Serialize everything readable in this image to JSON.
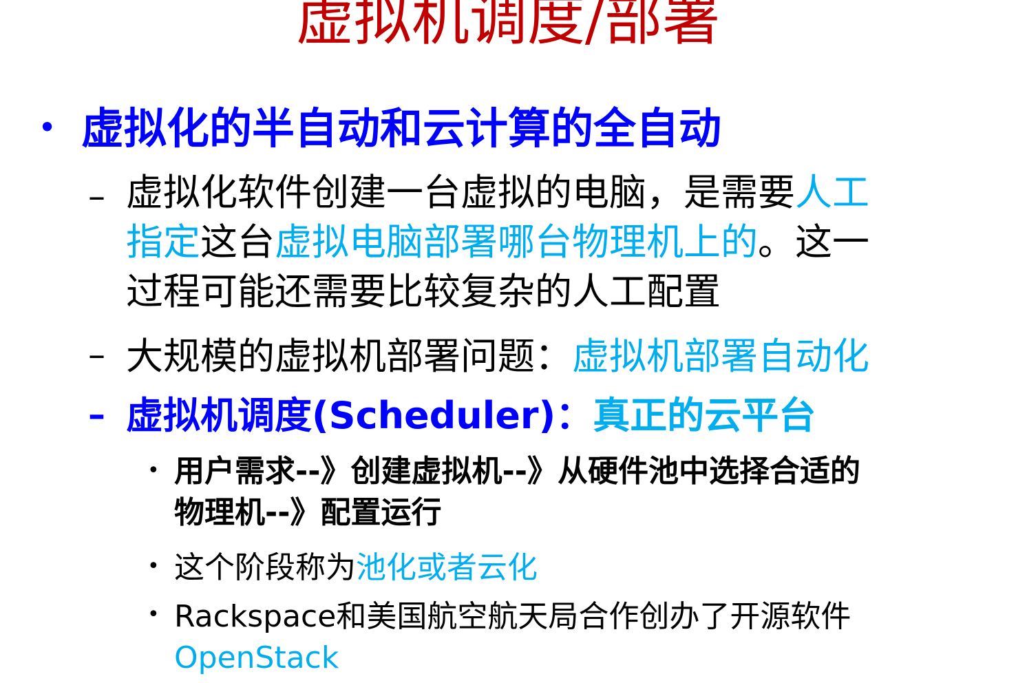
{
  "title": "虚拟机调度/部署",
  "bullet_l1": "•",
  "dash": "–",
  "bullet_l3": "•",
  "items": {
    "main": "虚拟化的半自动和云计算的全自动",
    "sub1": {
      "line1_a": "虚拟化软件创建一台虚拟的电脑，是需要",
      "line1_b": "人工",
      "line2_a": "指定",
      "line2_b": "这台",
      "line2_c": "虚拟电脑部署哪台物理机上的",
      "line2_d": "。这一",
      "line3": "过程可能还需要比较复杂的人工配置"
    },
    "sub2": {
      "text": "大规模的虚拟机部署问题：",
      "highlight": "虚拟机部署自动化"
    },
    "sub3": {
      "text": "虚拟机调度(Scheduler)：",
      "highlight": "真正的云平台"
    },
    "point1": {
      "line1": "用户需求--》创建虚拟机--》从硬件池中选择合适的",
      "line2": "物理机--》配置运行"
    },
    "point2": {
      "text": "这个阶段称为",
      "highlight": "池化或者云化"
    },
    "point3": {
      "line1": "Rackspace和美国航空航天局合作创办了开源软件",
      "highlight": "OpenStack"
    }
  },
  "colors": {
    "title": "#c00000",
    "heading": "#0000ff",
    "highlight": "#00aeef",
    "text": "#000000"
  }
}
